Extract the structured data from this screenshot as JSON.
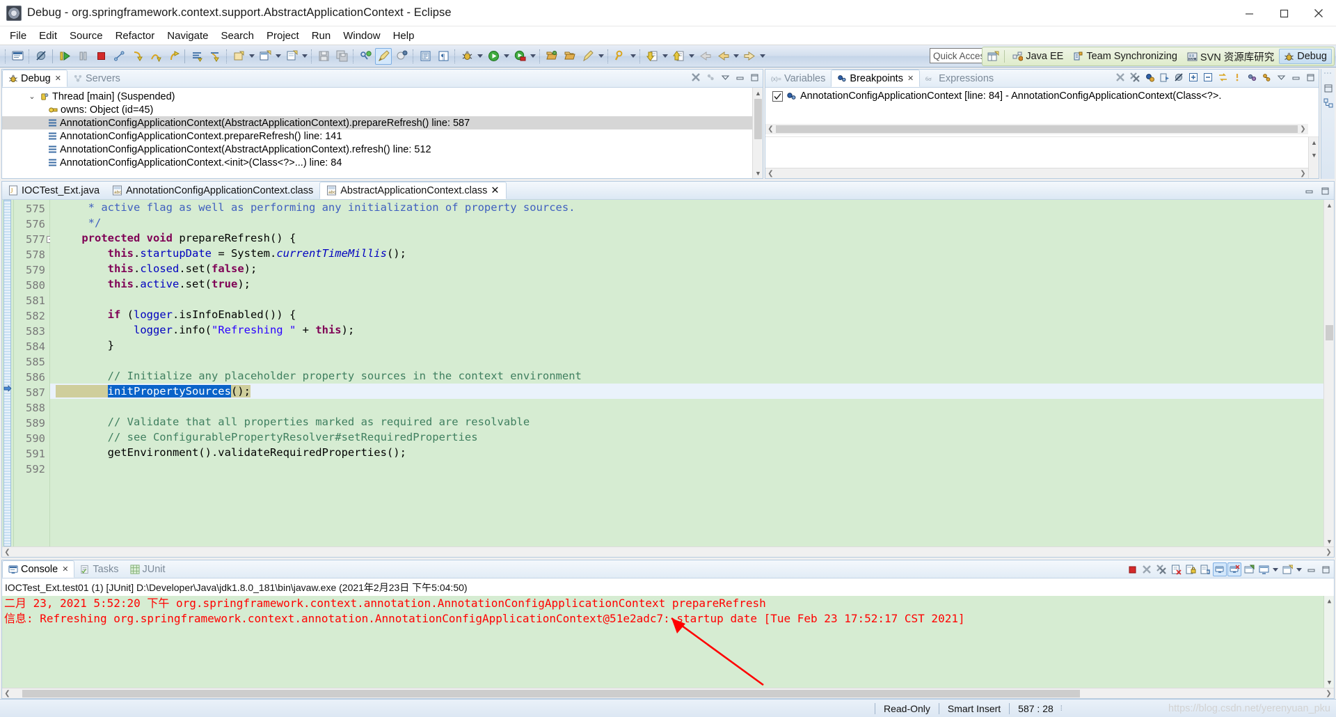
{
  "window": {
    "title": "Debug - org.springframework.context.support.AbstractApplicationContext - Eclipse",
    "app_icon": "eclipse-icon",
    "minimize": "minimize-button",
    "maximize": "maximize-button",
    "close": "close-button"
  },
  "menubar": {
    "items": [
      {
        "label": "File"
      },
      {
        "label": "Edit"
      },
      {
        "label": "Source"
      },
      {
        "label": "Refactor"
      },
      {
        "label": "Navigate"
      },
      {
        "label": "Search"
      },
      {
        "label": "Project"
      },
      {
        "label": "Run"
      },
      {
        "label": "Window"
      },
      {
        "label": "Help"
      }
    ]
  },
  "toolbar": {
    "quick_access_placeholder": "Quick Access",
    "quick_access_value": "",
    "buttons": [
      {
        "name": "new-java-console-icon"
      },
      {
        "name": "skip-all-breakpoints-icon"
      },
      {
        "name": "resume-icon"
      },
      {
        "name": "suspend-icon"
      },
      {
        "name": "terminate-icon"
      },
      {
        "name": "disconnect-icon"
      },
      {
        "name": "step-into-icon"
      },
      {
        "name": "step-over-icon"
      },
      {
        "name": "step-return-icon"
      },
      {
        "name": "drop-to-frame-icon"
      },
      {
        "name": "use-step-filters-icon"
      },
      {
        "name": "new-java-project-icon"
      },
      {
        "name": "new-wizard-icon"
      },
      {
        "name": "save-icon"
      },
      {
        "name": "save-all-icon"
      },
      {
        "name": "next-annotation-icon"
      },
      {
        "name": "toggle-mark-occurrences-icon"
      },
      {
        "name": "build-all-icon"
      },
      {
        "name": "open-type-icon"
      },
      {
        "name": "show-whitespace-icon"
      },
      {
        "name": "debug-icon"
      },
      {
        "name": "run-icon"
      },
      {
        "name": "run-coverage-icon"
      },
      {
        "name": "open-perspective-icon"
      },
      {
        "name": "open-folder-icon"
      },
      {
        "name": "search-icon"
      },
      {
        "name": "next-edit-location-icon"
      },
      {
        "name": "previous-edit-location-icon"
      },
      {
        "name": "back-icon"
      },
      {
        "name": "forward-icon"
      }
    ]
  },
  "perspectives": {
    "open_perspective": "open-perspective-button",
    "items": [
      {
        "label": "Java EE",
        "icon": "java-ee-icon",
        "selected": false
      },
      {
        "label": "Team Synchronizing",
        "icon": "team-sync-icon",
        "selected": false
      },
      {
        "label": "SVN 资源库研究",
        "icon": "svn-icon",
        "selected": false
      },
      {
        "label": "Debug",
        "icon": "debug-perspective-icon",
        "selected": true
      }
    ]
  },
  "debug_view": {
    "tabs": [
      {
        "label": "Debug",
        "icon": "debug-icon",
        "active": true,
        "closable": true
      },
      {
        "label": "Servers",
        "icon": "servers-icon",
        "active": false,
        "closable": false
      }
    ],
    "toolbar": [
      {
        "name": "remove-all-terminated-icon"
      },
      {
        "name": "menu-dropdown-icon"
      },
      {
        "name": "view-menu-icon"
      },
      {
        "name": "minimize-view-icon"
      },
      {
        "name": "maximize-view-icon"
      }
    ],
    "tree": [
      {
        "label": "Thread [main] (Suspended)",
        "icon": "thread-icon",
        "indent": 0,
        "twisty": "expanded",
        "selected": false
      },
      {
        "label": "owns: Object  (id=45)",
        "icon": "monitor-icon",
        "indent": 1,
        "twisty": "",
        "selected": false
      },
      {
        "label": "AnnotationConfigApplicationContext(AbstractApplicationContext).prepareRefresh() line: 587",
        "icon": "stack-frame-icon",
        "indent": 1,
        "twisty": "",
        "selected": true
      },
      {
        "label": "AnnotationConfigApplicationContext.prepareRefresh() line: 141",
        "icon": "stack-frame-icon",
        "indent": 1,
        "twisty": "",
        "selected": false
      },
      {
        "label": "AnnotationConfigApplicationContext(AbstractApplicationContext).refresh() line: 512",
        "icon": "stack-frame-icon",
        "indent": 1,
        "twisty": "",
        "selected": false
      },
      {
        "label": "AnnotationConfigApplicationContext.<init>(Class<?>...) line: 84",
        "icon": "stack-frame-icon",
        "indent": 1,
        "twisty": "",
        "selected": false
      }
    ]
  },
  "breakpoints_view": {
    "tabs": [
      {
        "label": "Variables",
        "icon": "variables-icon",
        "active": false,
        "closable": false
      },
      {
        "label": "Breakpoints",
        "icon": "breakpoints-icon",
        "active": true,
        "closable": true
      },
      {
        "label": "Expressions",
        "icon": "expressions-icon",
        "active": false,
        "closable": false
      }
    ],
    "toolbar": [
      {
        "name": "remove-breakpoint-icon"
      },
      {
        "name": "remove-all-breakpoints-icon"
      },
      {
        "name": "show-breakpoints-supported-icon"
      },
      {
        "name": "go-to-file-icon"
      },
      {
        "name": "skip-all-breakpoints-icon"
      },
      {
        "name": "expand-all-icon"
      },
      {
        "name": "collapse-all-icon"
      },
      {
        "name": "link-with-debug-view-icon"
      },
      {
        "name": "add-java-exception-breakpoint-icon"
      },
      {
        "name": "working-sets-icon"
      },
      {
        "name": "breakpoint-group-icon"
      },
      {
        "name": "view-menu-icon"
      },
      {
        "name": "minimize-view-icon"
      },
      {
        "name": "maximize-view-icon"
      }
    ],
    "rows": [
      {
        "checked": true,
        "icon": "breakpoint-icon",
        "label": "AnnotationConfigApplicationContext [line: 84] - AnnotationConfigApplicationContext(Class<?>."
      }
    ]
  },
  "editor": {
    "tabs": [
      {
        "label": "IOCTest_Ext.java",
        "icon": "java-file-icon",
        "active": false,
        "closable": false
      },
      {
        "label": "AnnotationConfigApplicationContext.class",
        "icon": "class-file-icon",
        "active": false,
        "closable": false
      },
      {
        "label": "AbstractApplicationContext.class",
        "icon": "class-file-icon",
        "active": true,
        "closable": true
      }
    ],
    "toolbar": [
      {
        "name": "minimize-editor-icon"
      },
      {
        "name": "maximize-editor-icon"
      }
    ],
    "lines": [
      {
        "number": "575",
        "fold": false,
        "current": false,
        "breakpoint": false,
        "tokens": [
          {
            "text": "     * active flag as well as performing any initialization of property sources.",
            "cls": "tok-jdoc"
          }
        ]
      },
      {
        "number": "576",
        "fold": false,
        "current": false,
        "breakpoint": false,
        "tokens": [
          {
            "text": "     */",
            "cls": "tok-jdoc"
          }
        ]
      },
      {
        "number": "577",
        "fold": true,
        "current": false,
        "breakpoint": false,
        "tokens": [
          {
            "text": "    ",
            "cls": "tok-plain"
          },
          {
            "text": "protected void ",
            "cls": "tok-kw"
          },
          {
            "text": "prepareRefresh() {",
            "cls": "tok-plain"
          }
        ]
      },
      {
        "number": "578",
        "fold": false,
        "current": false,
        "breakpoint": false,
        "tokens": [
          {
            "text": "        ",
            "cls": "tok-plain"
          },
          {
            "text": "this",
            "cls": "tok-kw"
          },
          {
            "text": ".",
            "cls": "tok-plain"
          },
          {
            "text": "startupDate",
            "cls": "tok-field"
          },
          {
            "text": " = System.",
            "cls": "tok-plain"
          },
          {
            "text": "currentTimeMillis",
            "cls": "tok-static"
          },
          {
            "text": "();",
            "cls": "tok-plain"
          }
        ]
      },
      {
        "number": "579",
        "fold": false,
        "current": false,
        "breakpoint": false,
        "tokens": [
          {
            "text": "        ",
            "cls": "tok-plain"
          },
          {
            "text": "this",
            "cls": "tok-kw"
          },
          {
            "text": ".",
            "cls": "tok-plain"
          },
          {
            "text": "closed",
            "cls": "tok-field"
          },
          {
            "text": ".set(",
            "cls": "tok-plain"
          },
          {
            "text": "false",
            "cls": "tok-kw"
          },
          {
            "text": ");",
            "cls": "tok-plain"
          }
        ]
      },
      {
        "number": "580",
        "fold": false,
        "current": false,
        "breakpoint": false,
        "tokens": [
          {
            "text": "        ",
            "cls": "tok-plain"
          },
          {
            "text": "this",
            "cls": "tok-kw"
          },
          {
            "text": ".",
            "cls": "tok-plain"
          },
          {
            "text": "active",
            "cls": "tok-field"
          },
          {
            "text": ".set(",
            "cls": "tok-plain"
          },
          {
            "text": "true",
            "cls": "tok-kw"
          },
          {
            "text": ");",
            "cls": "tok-plain"
          }
        ]
      },
      {
        "number": "581",
        "fold": false,
        "current": false,
        "breakpoint": false,
        "tokens": [
          {
            "text": "",
            "cls": "tok-plain"
          }
        ]
      },
      {
        "number": "582",
        "fold": false,
        "current": false,
        "breakpoint": false,
        "tokens": [
          {
            "text": "        ",
            "cls": "tok-plain"
          },
          {
            "text": "if",
            "cls": "tok-kw"
          },
          {
            "text": " (",
            "cls": "tok-plain"
          },
          {
            "text": "logger",
            "cls": "tok-field"
          },
          {
            "text": ".isInfoEnabled()) {",
            "cls": "tok-plain"
          }
        ]
      },
      {
        "number": "583",
        "fold": false,
        "current": false,
        "breakpoint": false,
        "tokens": [
          {
            "text": "            ",
            "cls": "tok-plain"
          },
          {
            "text": "logger",
            "cls": "tok-field"
          },
          {
            "text": ".info(",
            "cls": "tok-plain"
          },
          {
            "text": "\"Refreshing \"",
            "cls": "tok-str"
          },
          {
            "text": " + ",
            "cls": "tok-plain"
          },
          {
            "text": "this",
            "cls": "tok-kw"
          },
          {
            "text": ");",
            "cls": "tok-plain"
          }
        ]
      },
      {
        "number": "584",
        "fold": false,
        "current": false,
        "breakpoint": false,
        "tokens": [
          {
            "text": "        }",
            "cls": "tok-plain"
          }
        ]
      },
      {
        "number": "585",
        "fold": false,
        "current": false,
        "breakpoint": false,
        "tokens": [
          {
            "text": "",
            "cls": "tok-plain"
          }
        ]
      },
      {
        "number": "586",
        "fold": false,
        "current": false,
        "breakpoint": false,
        "tokens": [
          {
            "text": "        // Initialize any placeholder property sources in the context environment",
            "cls": "tok-cmt"
          }
        ]
      },
      {
        "number": "587",
        "fold": false,
        "current": true,
        "breakpoint": true,
        "tokens": [
          {
            "text": "        ",
            "cls": "tok-plain"
          },
          {
            "text": "initPropertySources",
            "cls": "sel-hl"
          },
          {
            "text": "();",
            "cls": "tok-plain"
          }
        ]
      },
      {
        "number": "588",
        "fold": false,
        "current": false,
        "breakpoint": false,
        "tokens": [
          {
            "text": "",
            "cls": "tok-plain"
          }
        ]
      },
      {
        "number": "589",
        "fold": false,
        "current": false,
        "breakpoint": false,
        "tokens": [
          {
            "text": "        // Validate that all properties marked as required are resolvable",
            "cls": "tok-cmt"
          }
        ]
      },
      {
        "number": "590",
        "fold": false,
        "current": false,
        "breakpoint": false,
        "tokens": [
          {
            "text": "        // see ConfigurablePropertyResolver#setRequiredProperties",
            "cls": "tok-cmt"
          }
        ]
      },
      {
        "number": "591",
        "fold": false,
        "current": false,
        "breakpoint": false,
        "tokens": [
          {
            "text": "        getEnvironment().validateRequiredProperties();",
            "cls": "tok-plain"
          }
        ]
      },
      {
        "number": "592",
        "fold": false,
        "current": false,
        "breakpoint": false,
        "tokens": [
          {
            "text": "",
            "cls": "tok-plain"
          }
        ]
      }
    ]
  },
  "console_view": {
    "tabs": [
      {
        "label": "Console",
        "icon": "console-icon",
        "active": true,
        "closable": true
      },
      {
        "label": "Tasks",
        "icon": "tasks-icon",
        "active": false,
        "closable": false
      },
      {
        "label": "JUnit",
        "icon": "junit-icon",
        "active": false,
        "closable": false
      }
    ],
    "toolbar": [
      {
        "name": "terminate-icon"
      },
      {
        "name": "remove-launch-icon"
      },
      {
        "name": "remove-all-terminated-launches-icon"
      },
      {
        "name": "clear-console-icon"
      },
      {
        "name": "lock-scroll-icon"
      },
      {
        "name": "show-console-on-output-icon"
      },
      {
        "name": "pin-console-icon"
      },
      {
        "name": "display-selected-console-icon"
      },
      {
        "name": "open-console-icon"
      },
      {
        "name": "new-console-view-icon"
      },
      {
        "name": "minimize-view-icon"
      },
      {
        "name": "maximize-view-icon"
      }
    ],
    "process_label": "IOCTest_Ext.test01 (1) [JUnit] D:\\Developer\\Java\\jdk1.8.0_181\\bin\\javaw.exe (2021年2月23日 下午5:04:50)",
    "output_color": "#ff0000",
    "output_lines": [
      "二月 23, 2021 5:52:20 下午 org.springframework.context.annotation.AnnotationConfigApplicationContext prepareRefresh",
      "信息: Refreshing org.springframework.context.annotation.AnnotationConfigApplicationContext@51e2adc7: startup date [Tue Feb 23 17:52:17 CST 2021]"
    ],
    "annotation_arrow": "red-arrow-annotation"
  },
  "statusbar": {
    "read_only": "Read-Only",
    "insert_mode": "Smart Insert",
    "position": "587 : 28",
    "watermark": "https://blog.csdn.net/yerenyuan_pku"
  }
}
